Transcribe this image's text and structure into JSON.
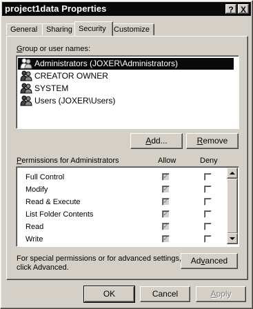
{
  "window": {
    "title": "project1data Properties",
    "help_label": "?",
    "close_label": "X"
  },
  "tabs": [
    {
      "label": "General",
      "active": false
    },
    {
      "label": "Sharing",
      "active": false
    },
    {
      "label": "Security",
      "active": true
    },
    {
      "label": "Customize",
      "active": false
    }
  ],
  "security": {
    "group_label_prefix": "G",
    "group_label_rest": "roup or user names:",
    "users": [
      {
        "name": "Administrators (JOXER\\Administrators)",
        "selected": true,
        "icon": "user-group-icon"
      },
      {
        "name": "CREATOR OWNER",
        "selected": false,
        "icon": "user-group-icon"
      },
      {
        "name": "SYSTEM",
        "selected": false,
        "icon": "user-group-icon"
      },
      {
        "name": "Users (JOXER\\Users)",
        "selected": false,
        "icon": "user-group-icon"
      }
    ],
    "add_label_prefix": "A",
    "add_label_rest": "dd...",
    "remove_label_prefix": "R",
    "remove_label_rest": "emove",
    "permissions_label_prefix": "P",
    "permissions_label_rest": "ermissions for Administrators",
    "allow_header": "Allow",
    "deny_header": "Deny",
    "permissions": [
      {
        "name": "Full Control",
        "allow": true,
        "deny": false
      },
      {
        "name": "Modify",
        "allow": true,
        "deny": false
      },
      {
        "name": "Read & Execute",
        "allow": true,
        "deny": false
      },
      {
        "name": "List Folder Contents",
        "allow": true,
        "deny": false
      },
      {
        "name": "Read",
        "allow": true,
        "deny": false
      },
      {
        "name": "Write",
        "allow": true,
        "deny": false
      }
    ],
    "special_text_line1": "For special permissions or for advanced settings,",
    "special_text_line2": "click Advanced.",
    "advanced_label_prefix": "Ad",
    "advanced_label_u": "v",
    "advanced_label_rest": "anced",
    "check_glyph": "✓"
  },
  "footer": {
    "ok_label": "OK",
    "cancel_label": "Cancel",
    "apply_label_prefix": "A",
    "apply_label_rest": "pply"
  },
  "colors": {
    "face": "#d4d0c8",
    "selection": "#0a0a0a",
    "titlebar": "#0a0a0a"
  }
}
